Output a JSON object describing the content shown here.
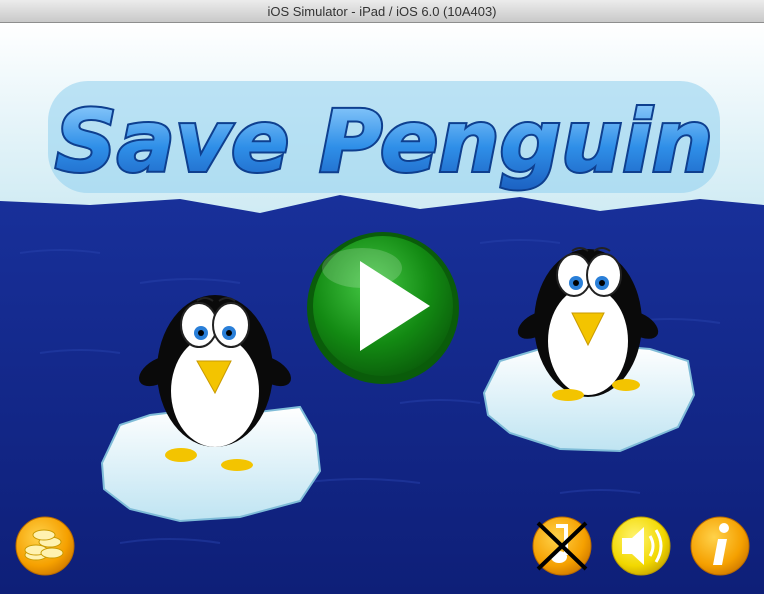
{
  "window": {
    "title": "iOS Simulator - iPad / iOS 6.0 (10A403)"
  },
  "game": {
    "logo_text": "Save Penguin",
    "play_button": {
      "icon": "play-icon"
    },
    "bottom_left": [
      {
        "name": "coins-button",
        "icon": "coins-icon"
      }
    ],
    "bottom_right": [
      {
        "name": "music-toggle-button",
        "icon": "music-muted-icon"
      },
      {
        "name": "sound-toggle-button",
        "icon": "speaker-icon"
      },
      {
        "name": "info-button",
        "icon": "info-icon"
      }
    ],
    "colors": {
      "sky_top": "#ffffff",
      "sky_bottom": "#cdeaf3",
      "sea": "#13288a",
      "logo_fill": "#2f8fe8",
      "play_green": "#1a9a1a",
      "hud_orange": "#f5a000",
      "penguin_black": "#0a0a0a",
      "beak_yellow": "#f3c400"
    }
  }
}
